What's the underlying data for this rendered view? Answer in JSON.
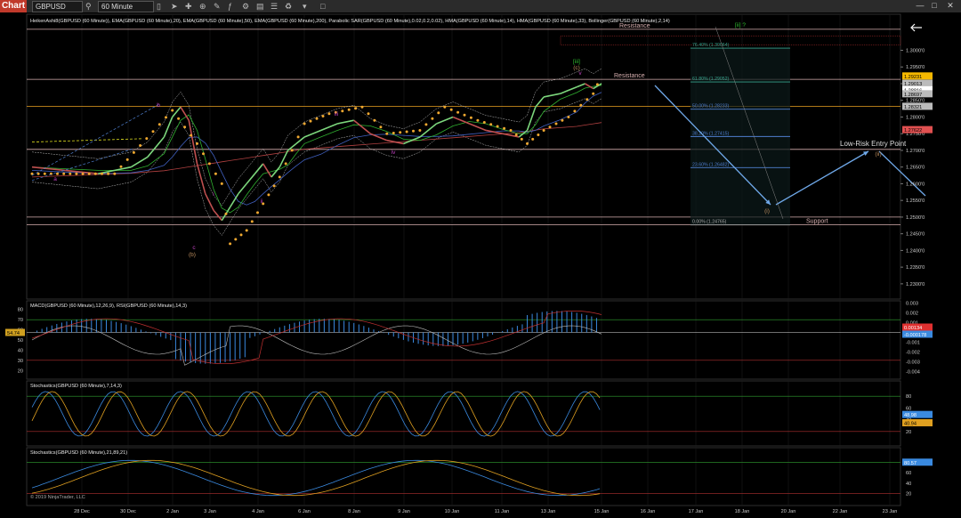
{
  "toolbar": {
    "tab_label": "Chart",
    "instrument": "GBPUSD",
    "interval": "60 Minute"
  },
  "panels": {
    "price_header": "HeikenAshi8(GBPUSD (60 Minute)), EMA(GBPUSD (60 Minute),20), EMA(GBPUSD (60 Minute),50), EMA(GBPUSD (60 Minute),200), Parabolic SAR(GBPUSD (60 Minute),0.02,0.2,0.02), HMA(GBPUSD (60 Minute),14), HMA(GBPUSD (60 Minute),33), Bollinger(GBPUSD (60 Minute),2,14)",
    "macd_header": "MACD(GBPUSD (60 Minute),12,26,9), RSI(GBPUSD (60 Minute),14,3)",
    "stoch1_header": "Stochastics(GBPUSD (60 Minute),7,14,3)",
    "stoch2_header": "Stochastics(GBPUSD (60 Minute),21,89,21)",
    "copyright": "© 2019 NinjaTrader, LLC"
  },
  "chart_data": {
    "type": "line",
    "x_ticks": [
      "28 Dec",
      "30 Dec",
      "2 Jan",
      "3 Jan",
      "4 Jan",
      "6 Jan",
      "8 Jan",
      "9 Jan",
      "10 Jan",
      "11 Jan",
      "13 Jan",
      "15 Jan",
      "16 Jan",
      "17 Jan",
      "18 Jan",
      "20 Jan",
      "22 Jan",
      "23 Jan"
    ],
    "price": {
      "ylim": [
        1.2265,
        1.306
      ],
      "y_ticks": [
        1.3,
        1.295,
        1.29,
        1.285,
        1.28,
        1.275,
        1.27,
        1.265,
        1.26,
        1.255,
        1.25,
        1.245,
        1.24,
        1.235,
        1.23
      ],
      "y_tick_labels": [
        "1.3000'0",
        "1.2950'0",
        "1.2900'0",
        "1.2850'0",
        "1.2800'0",
        "1.2750'0",
        "1.2700'0",
        "1.2650'0",
        "1.2600'0",
        "1.2550'0",
        "1.2500'0",
        "1.2450'0",
        "1.2400'0",
        "1.2350'0",
        "1.2300'0"
      ],
      "close_path": [
        [
          0,
          1.265
        ],
        [
          4,
          1.264
        ],
        [
          8,
          1.263
        ],
        [
          12,
          1.265
        ],
        [
          14,
          1.268
        ],
        [
          16,
          1.274
        ],
        [
          17,
          1.28
        ],
        [
          18,
          1.283
        ],
        [
          19,
          1.279
        ],
        [
          20,
          1.266
        ],
        [
          21,
          1.257
        ],
        [
          22,
          1.252
        ],
        [
          23,
          1.249
        ],
        [
          24,
          1.253
        ],
        [
          25,
          1.257
        ],
        [
          26,
          1.26
        ],
        [
          27,
          1.263
        ],
        [
          28,
          1.266
        ],
        [
          29,
          1.262
        ],
        [
          30,
          1.265
        ],
        [
          31,
          1.27
        ],
        [
          32,
          1.272
        ],
        [
          33,
          1.274
        ],
        [
          35,
          1.276
        ],
        [
          37,
          1.278
        ],
        [
          39,
          1.279
        ],
        [
          41,
          1.275
        ],
        [
          43,
          1.273
        ],
        [
          45,
          1.272
        ],
        [
          47,
          1.274
        ],
        [
          49,
          1.278
        ],
        [
          51,
          1.28
        ],
        [
          53,
          1.278
        ],
        [
          55,
          1.276
        ],
        [
          57,
          1.275
        ],
        [
          59,
          1.274
        ],
        [
          60,
          1.276
        ],
        [
          61,
          1.283
        ],
        [
          62,
          1.286
        ],
        [
          64,
          1.287
        ],
        [
          66,
          1.289
        ],
        [
          67,
          1.29
        ],
        [
          68,
          1.2885
        ],
        [
          69,
          1.29
        ]
      ],
      "sar_path": [
        [
          0,
          1.263
        ],
        [
          10,
          1.263
        ],
        [
          17,
          1.282
        ],
        [
          20,
          1.272
        ],
        [
          23,
          1.26
        ],
        [
          24,
          1.242
        ],
        [
          26,
          1.246
        ],
        [
          28,
          1.254
        ],
        [
          30,
          1.262
        ],
        [
          33,
          1.278
        ],
        [
          36,
          1.281
        ],
        [
          40,
          1.283
        ],
        [
          43,
          1.275
        ],
        [
          47,
          1.276
        ],
        [
          50,
          1.283
        ],
        [
          54,
          1.279
        ],
        [
          58,
          1.276
        ],
        [
          60,
          1.272
        ],
        [
          62,
          1.276
        ],
        [
          65,
          1.28
        ],
        [
          68,
          1.287
        ],
        [
          69,
          1.2925
        ]
      ],
      "current_value_label": "1.28816",
      "right_labels": [
        {
          "value": 1.29231,
          "text": "1.29231",
          "color": "#f5b800"
        },
        {
          "value": 1.29013,
          "text": "1.29013",
          "color": "#bbbbbb"
        },
        {
          "value": 1.28816,
          "text": "1.28816",
          "color": "#ffffff"
        },
        {
          "value": 1.28697,
          "text": "1.28697",
          "color": "#bbbbbb"
        },
        {
          "value": 1.28321,
          "text": "1.28321",
          "color": "#bbbbbb"
        },
        {
          "value": 1.27622,
          "text": "1.27622",
          "color": "#e05050"
        }
      ],
      "levels": [
        {
          "value": 1.3063,
          "color": "#d8b0b0",
          "label": "Resistance"
        },
        {
          "value": 1.2913,
          "color": "#d8b0b0",
          "label": "Resistance"
        },
        {
          "value": 1.2832,
          "color": "#e8a020",
          "label": ""
        },
        {
          "value": 1.2703,
          "color": "#d8b0b0",
          "label": ""
        },
        {
          "value": 1.25,
          "color": "#d8b0b0",
          "label": ""
        },
        {
          "value": 1.2477,
          "color": "#d8b0b0",
          "label": "Support"
        }
      ],
      "fib_levels": [
        {
          "value": 1.30064,
          "label": "76.40% (1.30064)",
          "color": "#35a08a"
        },
        {
          "value": 1.29052,
          "label": "61.80% (1.29052)",
          "color": "#35a08a"
        },
        {
          "value": 1.28233,
          "label": "50.00% (1.28233)",
          "color": "#4f7fd0"
        },
        {
          "value": 1.27415,
          "label": "38.20% (1.27415)",
          "color": "#4f7fd0"
        },
        {
          "value": 1.26482,
          "label": "23.60% (1.26482)",
          "color": "#4f7fd0"
        },
        {
          "value": 1.24765,
          "label": "0.00% (1.24765)",
          "color": "#aaaaaa"
        }
      ],
      "annotations": {
        "entry": "Low-Risk Entry Point",
        "wave_labels": [
          "a",
          "b",
          "c",
          "(b)",
          "i",
          "ii",
          "iii",
          "iv",
          "v",
          "[iii]",
          "(c)",
          "(i)",
          "(ii)",
          "[ii] ?"
        ]
      }
    },
    "macd": {
      "left_ticks": [
        "80",
        "70",
        "60",
        "50",
        "40",
        "30",
        "20"
      ],
      "right_ticks": [
        "0.003",
        "0.002",
        "0.001",
        "0",
        "-0.001",
        "-0.002",
        "-0.003",
        "-0.004"
      ],
      "rsi_label": "54.74",
      "macd_value_label": "0.00134",
      "signal_value_label": "-0.000178"
    },
    "stoch1": {
      "ticks": [
        "80",
        "60",
        "40",
        "20"
      ],
      "k_label": "48.98",
      "d_label": "40.94"
    },
    "stoch2": {
      "ticks": [
        "80",
        "60",
        "40",
        "20"
      ],
      "k_label": "80.57",
      "d_label": "79.9"
    }
  }
}
